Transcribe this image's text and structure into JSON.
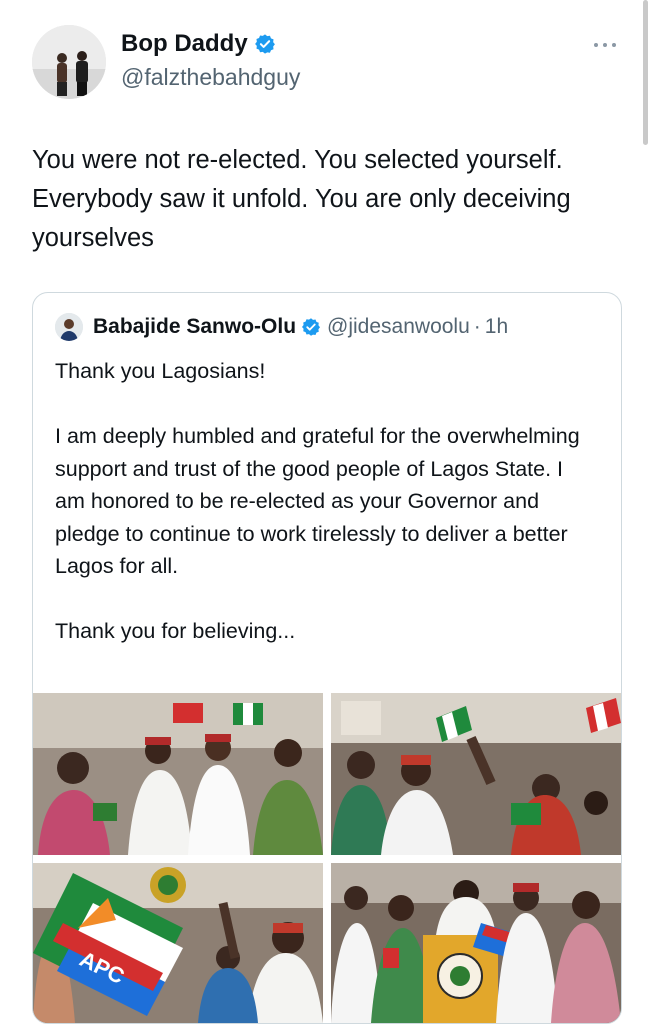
{
  "author": {
    "name": "Bop Daddy",
    "handle": "@falzthebahdguy",
    "verified": true
  },
  "tweet": {
    "text": "You were not re-elected. You selected yourself. Everybody saw it unfold. You are only deceiving yourselves"
  },
  "more_icon": "more-horizontal-icon",
  "quoted_tweet": {
    "name": "Babajide Sanwo-Olu",
    "handle": "@jidesanwoolu",
    "separator": "·",
    "time": "1h",
    "paragraphs": [
      "Thank you Lagosians!",
      "I am deeply humbled and grateful for the overwhelming support and trust of the good people of Lagos State. I am honored to be re-elected as your Governor and pledge to continue to work tirelessly to deliver a better Lagos for all.",
      "Thank you for believing..."
    ],
    "photo_lettering": {
      "flag": "APC"
    }
  },
  "colors": {
    "verified": "#1d9bf0",
    "text": "#0f1419",
    "muted": "#536471",
    "border": "#cfd9de"
  }
}
